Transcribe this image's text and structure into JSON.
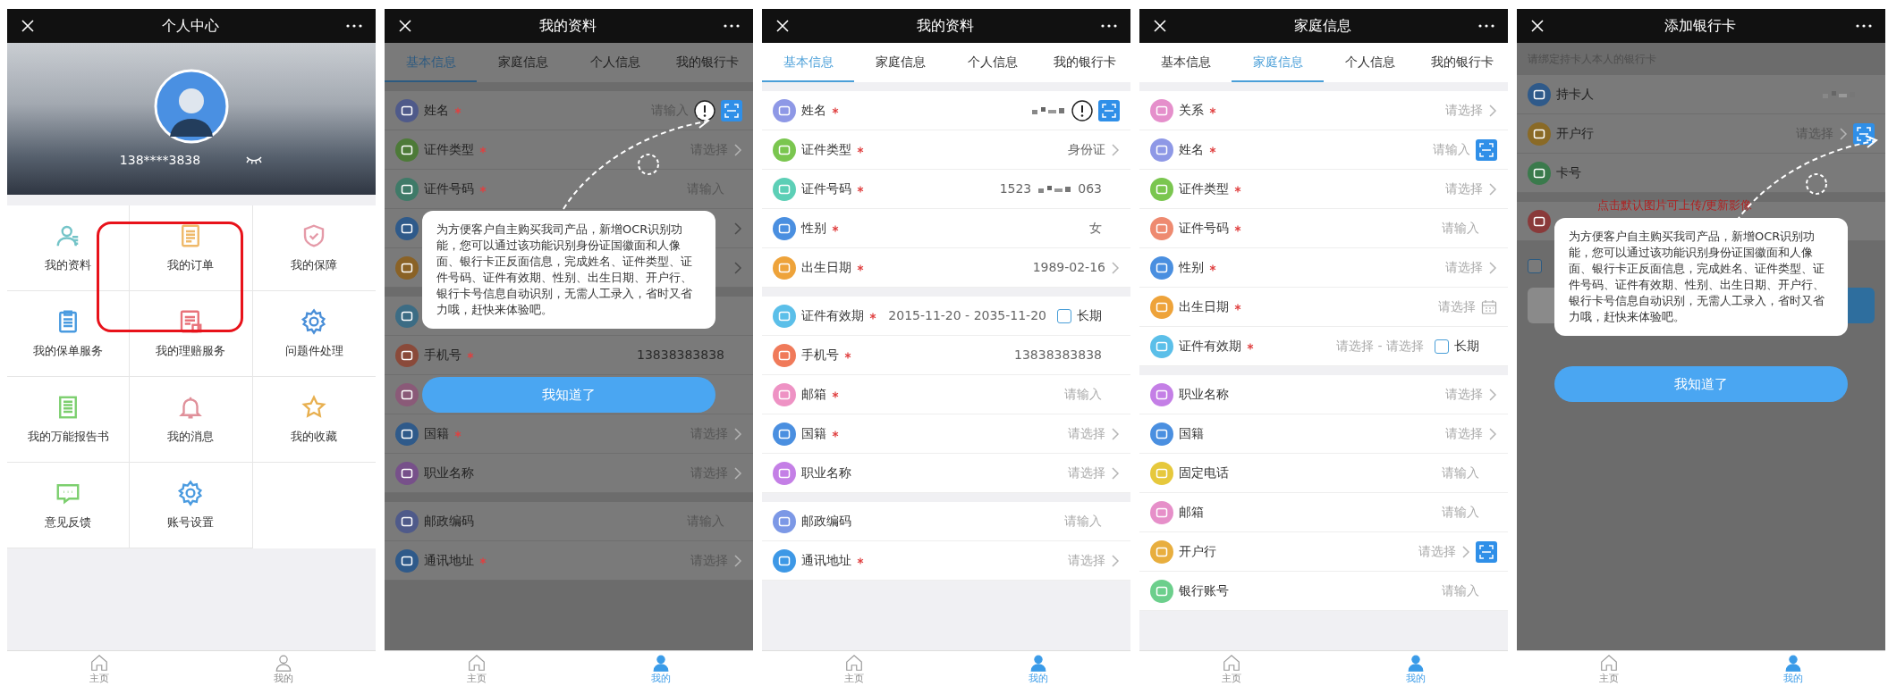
{
  "phones": [
    {
      "kind": "center",
      "title": "个人中心",
      "banner": {
        "phone": "138****3838"
      },
      "menu": [
        {
          "label": "我的资料",
          "kind": "person",
          "color": "#74c4c8"
        },
        {
          "label": "我的订单",
          "kind": "doc",
          "color": "#efb96a"
        },
        {
          "label": "我的保障",
          "kind": "shield",
          "color": "#e59aa8"
        },
        {
          "label": "我的保单服务",
          "kind": "clipboard",
          "color": "#4a9be0"
        },
        {
          "label": "我的理赔服务",
          "kind": "claim",
          "color": "#e8727a"
        },
        {
          "label": "问题件处理",
          "kind": "gear",
          "color": "#4a8fd8"
        },
        {
          "label": "我的万能报告书",
          "kind": "report",
          "color": "#7ccf6e"
        },
        {
          "label": "我的消息",
          "kind": "bell",
          "color": "#e0909a"
        },
        {
          "label": "我的收藏",
          "kind": "star",
          "color": "#e8b050"
        },
        {
          "label": "意见反馈",
          "kind": "chat",
          "color": "#7ccf6e"
        },
        {
          "label": "账号设置",
          "kind": "gear",
          "color": "#4a9be0"
        }
      ],
      "nav": [
        {
          "label": "主页",
          "kind": "home",
          "selected": false
        },
        {
          "label": "我的",
          "kind": "profile",
          "selected": false
        }
      ]
    },
    {
      "kind": "form",
      "title": "我的资料",
      "dimmed": true,
      "tabs": [
        {
          "label": "基本信息",
          "selected": true
        },
        {
          "label": "家庭信息",
          "selected": false
        },
        {
          "label": "个人信息",
          "selected": false
        },
        {
          "label": "我的银行卡",
          "selected": false
        }
      ],
      "sections": [
        [
          {
            "kind": "field",
            "label": "姓名",
            "required": true,
            "color": "#4f5a8a",
            "placeholder": "请输入",
            "info": true,
            "ocr": true
          },
          {
            "kind": "field",
            "label": "证件类型",
            "required": true,
            "color": "#4d7a38",
            "placeholder": "请选择",
            "chevron": true
          },
          {
            "kind": "field",
            "label": "证件号码",
            "required": true,
            "color": "#3f7a68",
            "placeholder": "请输入"
          },
          {
            "kind": "covered",
            "color": "#2f5a8a",
            "chevron": true
          },
          {
            "kind": "covered",
            "color": "#8a6226",
            "chevron": true
          }
        ],
        [
          {
            "kind": "covered",
            "color": "#3c6c84"
          },
          {
            "kind": "field",
            "label": "手机号",
            "required": true,
            "color": "#8a4a3a",
            "value": "13838383838"
          },
          {
            "kind": "covered",
            "color": "#8a5a78"
          },
          {
            "kind": "field",
            "label": "国籍",
            "required": true,
            "color": "#2f5a8a",
            "placeholder": "请选择",
            "chevron": true
          },
          {
            "kind": "field",
            "label": "职业名称",
            "required": false,
            "color": "#77508a",
            "placeholder": "请选择",
            "chevron": true
          }
        ],
        [
          {
            "kind": "field",
            "label": "邮政编码",
            "required": false,
            "color": "#4f5a8a",
            "placeholder": "请输入"
          },
          {
            "kind": "field",
            "label": "通讯地址",
            "required": true,
            "color": "#2f5a8a",
            "placeholder": "请选择",
            "chevron": true
          }
        ]
      ],
      "tutorial": {
        "text": "为方便客户自主购买我司产品，新增OCR识别功能，您可以通过该功能识别身份证国徽面和人像面、银行卡正反面信息，完成姓名、证件类型、证件号码、证件有效期、性别、出生日期、开户行、银行卡号信息自动识别，无需人工录入，省时又省力哦，赶快来体验吧。",
        "button": "我知道了"
      },
      "nav": [
        {
          "label": "主页",
          "kind": "home",
          "selected": false
        },
        {
          "label": "我的",
          "kind": "profile",
          "selected": true
        }
      ]
    },
    {
      "kind": "form",
      "title": "我的资料",
      "dimmed": false,
      "tabs": [
        {
          "label": "基本信息",
          "selected": true
        },
        {
          "label": "家庭信息",
          "selected": false
        },
        {
          "label": "个人信息",
          "selected": false
        },
        {
          "label": "我的银行卡",
          "selected": false
        }
      ],
      "sections": [
        [
          {
            "kind": "field",
            "label": "姓名",
            "required": true,
            "color": "#8e98e6",
            "redacted": true,
            "info": true,
            "ocr": true
          },
          {
            "kind": "field",
            "label": "证件类型",
            "required": true,
            "color": "#7ac64f",
            "value": "身份证",
            "chevron": true
          },
          {
            "kind": "field",
            "label": "证件号码",
            "required": true,
            "color": "#5ccfb6",
            "value": "1523",
            "redacted": true,
            "value_end": "063"
          },
          {
            "kind": "field",
            "label": "性别",
            "required": true,
            "color": "#4a8fe0",
            "value": "女"
          },
          {
            "kind": "field",
            "label": "出生日期",
            "required": true,
            "color": "#eea33a",
            "value": "1989-02-16",
            "chevron": true
          }
        ],
        [
          {
            "kind": "validity",
            "label": "证件有效期",
            "required": true,
            "color": "#5bbfe9",
            "value": "2015-11-20 - 2035-11-20",
            "checkbox": {
              "label": "长期",
              "checked": false
            }
          },
          {
            "kind": "field",
            "label": "手机号",
            "required": true,
            "color": "#f07a5a",
            "value": "13838383838"
          },
          {
            "kind": "field",
            "label": "邮箱",
            "required": true,
            "color": "#ee92c4",
            "placeholder": "请输入"
          },
          {
            "kind": "field",
            "label": "国籍",
            "required": true,
            "color": "#4a8fe0",
            "placeholder": "请选择",
            "chevron": true
          },
          {
            "kind": "field",
            "label": "职业名称",
            "required": false,
            "color": "#c47fe6",
            "placeholder": "请选择",
            "chevron": true
          }
        ],
        [
          {
            "kind": "field",
            "label": "邮政编码",
            "required": false,
            "color": "#7c98e6",
            "placeholder": "请输入"
          },
          {
            "kind": "field",
            "label": "通讯地址",
            "required": true,
            "color": "#3d98e6",
            "placeholder": "请选择",
            "chevron": true
          }
        ]
      ],
      "nav": [
        {
          "label": "主页",
          "kind": "home",
          "selected": false
        },
        {
          "label": "我的",
          "kind": "profile",
          "selected": true
        }
      ]
    },
    {
      "kind": "form",
      "title": "家庭信息",
      "dimmed": false,
      "tabs": [
        {
          "label": "基本信息",
          "selected": false
        },
        {
          "label": "家庭信息",
          "selected": true
        },
        {
          "label": "个人信息",
          "selected": false
        },
        {
          "label": "我的银行卡",
          "selected": false
        }
      ],
      "sections": [
        [
          {
            "kind": "field",
            "label": "关系",
            "required": true,
            "color": "#e58fcb",
            "placeholder": "请选择",
            "chevron": true
          },
          {
            "kind": "field",
            "label": "姓名",
            "required": true,
            "color": "#8e98e6",
            "placeholder": "请输入",
            "ocr": true
          },
          {
            "kind": "field",
            "label": "证件类型",
            "required": true,
            "color": "#7ac64f",
            "placeholder": "请选择",
            "chevron": true
          },
          {
            "kind": "field",
            "label": "证件号码",
            "required": true,
            "color": "#ee8a70",
            "placeholder": "请输入"
          },
          {
            "kind": "field",
            "label": "性别",
            "required": true,
            "color": "#4a8fe0",
            "placeholder": "请选择",
            "chevron": true
          },
          {
            "kind": "field",
            "label": "出生日期",
            "required": true,
            "color": "#eea33a",
            "placeholder": "请选择",
            "calendar": true
          },
          {
            "kind": "validity",
            "label": "证件有效期",
            "required": true,
            "color": "#5bbfe9",
            "placeholder": "请选择 - 请选择",
            "checkbox": {
              "label": "长期",
              "checked": false
            }
          }
        ],
        [
          {
            "kind": "field",
            "label": "职业名称",
            "required": false,
            "color": "#c47fe6",
            "placeholder": "请选择",
            "chevron": true
          },
          {
            "kind": "field",
            "label": "国籍",
            "required": false,
            "color": "#4a8fe0",
            "placeholder": "请选择",
            "chevron": true
          },
          {
            "kind": "field",
            "label": "固定电话",
            "required": false,
            "color": "#e6c83c",
            "placeholder": "请输入"
          },
          {
            "kind": "field",
            "label": "邮箱",
            "required": false,
            "color": "#e68fc9",
            "placeholder": "请输入"
          },
          {
            "kind": "field",
            "label": "开户行",
            "required": false,
            "color": "#e8ae3e",
            "placeholder": "请选择",
            "chevron": true,
            "ocr": true
          },
          {
            "kind": "field",
            "label": "银行账号",
            "required": false,
            "color": "#6ccf8c",
            "placeholder": "请输入"
          }
        ]
      ],
      "nav": [
        {
          "label": "主页",
          "kind": "home",
          "selected": false
        },
        {
          "label": "我的",
          "kind": "profile",
          "selected": true
        }
      ]
    },
    {
      "kind": "card",
      "title": "添加银行卡",
      "dimmed": true,
      "hint": "请绑定持卡人本人的银行卡",
      "sections": [
        [
          {
            "kind": "field",
            "label": "持卡人",
            "required": false,
            "color": "#2f5a8a",
            "redacted": true
          },
          {
            "kind": "field",
            "label": "开户行",
            "required": false,
            "color": "#8a6a26",
            "placeholder": "请选择",
            "chevron": true,
            "ocr": true
          },
          {
            "kind": "field",
            "label": "卡号",
            "required": false,
            "color": "#3a7a4c"
          }
        ],
        [
          {
            "kind": "covered",
            "color": "#8a3a3a"
          }
        ]
      ],
      "agreement": {
        "checked": false
      },
      "tutorial": {
        "note": "点击默认图片可上传/更新影像",
        "text": "为方便客户自主购买我司产品，新增OCR识别功能，您可以通过该功能识别身份证国徽面和人像面、银行卡正反面信息，完成姓名、证件类型、证件号码、证件有效期、性别、出生日期、开户行、银行卡号信息自动识别，无需人工录入，省时又省力哦，赶快来体验吧。",
        "button": "我知道了"
      },
      "nav": [
        {
          "label": "主页",
          "kind": "home",
          "selected": false
        },
        {
          "label": "我的",
          "kind": "profile",
          "selected": true
        }
      ]
    }
  ]
}
